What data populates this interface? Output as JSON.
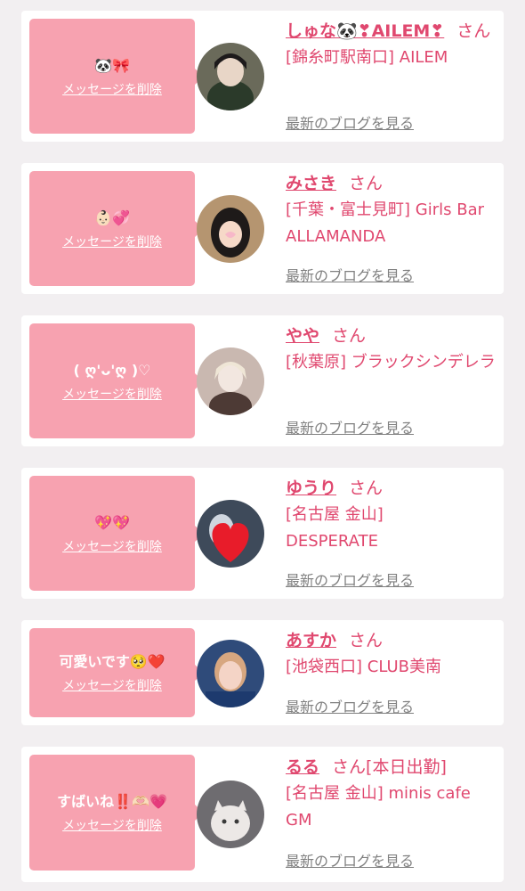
{
  "common": {
    "delete_label": "メッセージを削除",
    "blog_label": "最新のブログを見る",
    "san": "さん"
  },
  "cards": [
    {
      "bubble_text": "🐼🎀",
      "name": "しゅな🐼❣AILEM❣",
      "suffix": "",
      "shop": "[錦糸町駅南口] AILEM",
      "avatar_colors": [
        "#6a6a5a",
        "#d7cbb7",
        "#2b3a2a"
      ]
    },
    {
      "bubble_text": "👶🏻💞",
      "name": "みさき",
      "suffix": "",
      "shop": "[千葉・富士見町] Girls Bar ALLAMANDA",
      "avatar_colors": [
        "#b59570",
        "#f6d9c8",
        "#1e1a19"
      ]
    },
    {
      "bubble_text": "( ღ'ᴗ'ღ )♡",
      "name": "やや",
      "suffix": "",
      "shop": "[秋葉原] ブラックシンデレラ",
      "avatar_colors": [
        "#c9b8b0",
        "#f2e7e0",
        "#4d3a35"
      ]
    },
    {
      "bubble_text": "💖💖",
      "name": "ゆうり",
      "suffix": "",
      "shop": "[名古屋 金山] DESPERATE",
      "avatar_colors": [
        "#3e4a5a",
        "#cfd6df",
        "#e81c2a"
      ]
    },
    {
      "bubble_text": "可愛いです🥺❤️",
      "name": "あすか",
      "suffix": "",
      "shop": "[池袋西口] CLUB美南",
      "avatar_colors": [
        "#2f4b7a",
        "#f4d4c6",
        "#d7a780"
      ]
    },
    {
      "bubble_text": "すばいね‼️🫶🏻💗",
      "name": "るる",
      "suffix": "[本日出勤]",
      "shop": "[名古屋 金山] minis cafe GM",
      "avatar_colors": [
        "#6e6c70",
        "#ece8e6",
        "#b9a8a2"
      ]
    }
  ]
}
